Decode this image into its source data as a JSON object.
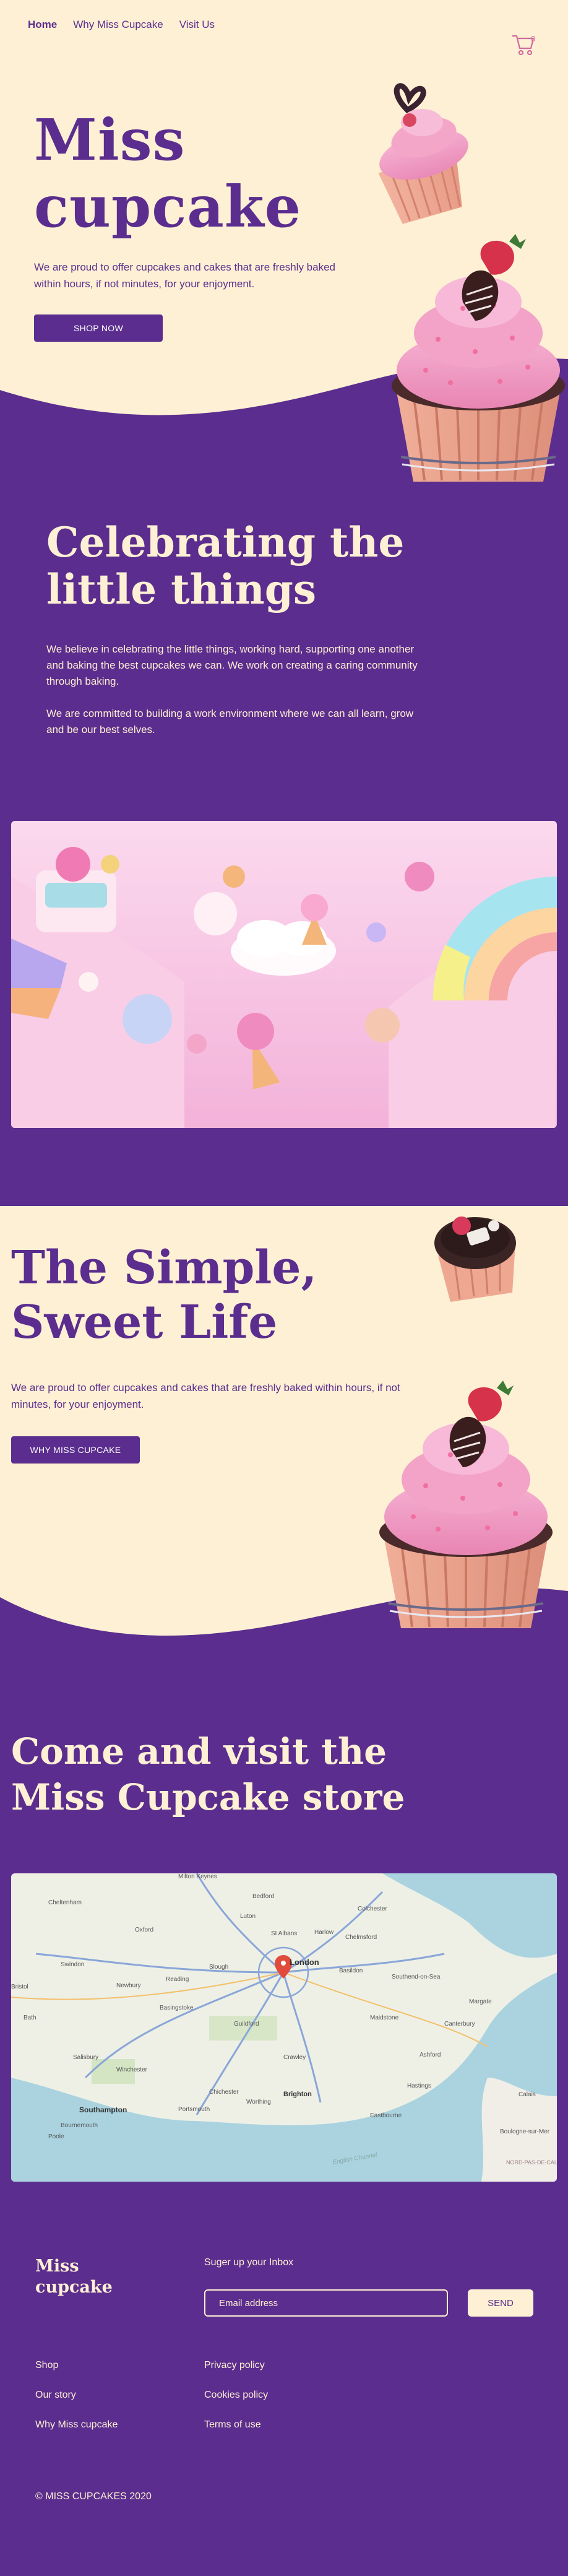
{
  "nav": {
    "items": [
      {
        "label": "Home",
        "active": true
      },
      {
        "label": "Why Miss Cupcake",
        "active": false
      },
      {
        "label": "Visit Us",
        "active": false
      }
    ],
    "cart_count": "0"
  },
  "hero": {
    "title_line1": "Miss",
    "title_line2": "cupcake",
    "text": "We are proud to offer cupcakes and cakes that are freshly baked within hours, if not minutes, for your enjoyment.",
    "button": "SHOP NOW"
  },
  "celebrate": {
    "title_line1": "Celebrating the",
    "title_line2": "little things",
    "para1": "We believe in celebrating the little things, working hard, supporting one another and baking the best cupcakes we can. We work on creating a caring community through baking.",
    "para2": "We are committed to building a work environment where we can all learn, grow and be our best selves."
  },
  "simple": {
    "title_line1": "The Simple,",
    "title_line2": "Sweet Life",
    "text": "We are proud to offer cupcakes and cakes that are freshly baked within hours, if not minutes, for your enjoyment.",
    "button": "WHY MISS CUPCAKE"
  },
  "visit": {
    "title_line1": "Come and visit the",
    "title_line2": "Miss Cupcake store"
  },
  "map": {
    "labels": [
      "Milton Keynes",
      "Bedford",
      "Colchester",
      "Cheltenham",
      "Luton",
      "Harlow",
      "Chelmsford",
      "Oxford",
      "St Albans",
      "Swindon",
      "Reading",
      "London",
      "Basildon",
      "Southend-on-Sea",
      "Bristol",
      "Slough",
      "Margate",
      "Canterbury",
      "Basingstoke",
      "Guildford",
      "Maidstone",
      "Ashford",
      "Salisbury",
      "Crawley",
      "Southampton",
      "Portsmouth",
      "Brighton",
      "Eastbourne",
      "Bournemouth",
      "Poole",
      "Hastings",
      "Boulogne-sur-Mer",
      "Calais",
      "NORD-PAS-DE-CALAIS",
      "English Channel",
      "Bath",
      "Newbury",
      "Winchester",
      "Chichester",
      "Worthing"
    ]
  },
  "footer": {
    "brand_line1": "Miss",
    "brand_line2": "cupcake",
    "newsletter_title": "Suger up your Inbox",
    "email_placeholder": "Email address",
    "send": "SEND",
    "col1": [
      "Shop",
      "Our story",
      "Why Miss cupcake"
    ],
    "col2": [
      "Privacy policy",
      "Cookies policy",
      "Terms of use"
    ],
    "copyright": "© MISS CUPCAKES 2020"
  },
  "colors": {
    "purple": "#5b2d8e",
    "cream": "#fdf0d4",
    "pink": "#f4a9cb"
  }
}
